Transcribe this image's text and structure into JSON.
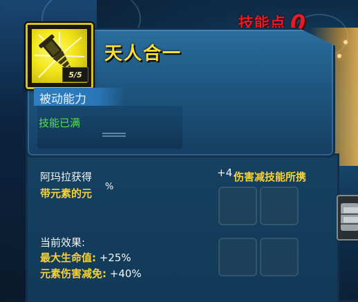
{
  "hud": {
    "skill_points_label": "技能点",
    "skill_points_value": "0"
  },
  "skill": {
    "name": "天人合一",
    "level": "5/5",
    "type": "被动能力",
    "status": "技能已满"
  },
  "description": {
    "line1": "阿玛拉获得",
    "line1_tail": "+4",
    "line2": "带元素的元",
    "line2_highlight": "伤害减技能所携",
    "line2_tail": "%"
  },
  "effects": {
    "title": "当前效果:",
    "stats": [
      {
        "name": "最大生命值:",
        "value": "+25%"
      },
      {
        "name": "元素伤害减免:",
        "value": "+40%"
      }
    ]
  },
  "colors": {
    "accent_yellow": "#fae036",
    "status_green": "#56e04b",
    "points_red": "#e21d2a",
    "panel_blue": "#1e5680"
  },
  "icons": {
    "skill_icon": "spike-fist-icon",
    "side_item": "armor-gauntlet-icon"
  }
}
